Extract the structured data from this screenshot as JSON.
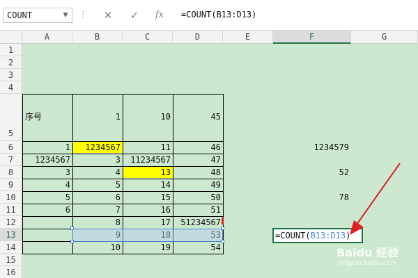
{
  "formula_bar": {
    "name_box": "COUNT",
    "cancel_icon": "✕",
    "enter_icon": "✓",
    "fx_label": "fx",
    "formula": "=COUNT(B13:D13)"
  },
  "columns": [
    "A",
    "B",
    "C",
    "D",
    "E",
    "F",
    "G"
  ],
  "active_column": "F",
  "rows": [
    "1",
    "2",
    "3",
    "4",
    "5",
    "6",
    "7",
    "8",
    "9",
    "10",
    "11",
    "12",
    "13",
    "14",
    "15",
    "16"
  ],
  "active_row": "13",
  "cells": {
    "A5": "序号",
    "B5": "1",
    "C5": "10",
    "D5": "45",
    "A6": "1",
    "B6": "1234567",
    "C6": "11",
    "D6": "46",
    "F6": "1234579",
    "A7": "1234567",
    "B7": "3",
    "C7": "11234567",
    "D7": "47",
    "A8": "3",
    "B8": "4",
    "C8": "13",
    "D8": "48",
    "F8": "52",
    "A9": "4",
    "B9": "5",
    "C9": "14",
    "D9": "49",
    "A10": "5",
    "B10": "6",
    "C10": "15",
    "D10": "50",
    "F10": "78",
    "A11": "6",
    "B11": "7",
    "C11": "16",
    "D11": "51",
    "B12": "8",
    "C12": "17",
    "D12": "51234567",
    "B13": "9",
    "C13": "18",
    "D13": "53",
    "B14": "10",
    "C14": "19",
    "D14": "54"
  },
  "highlighted_cells": [
    "B6",
    "C8"
  ],
  "editing_cell": {
    "address": "F13",
    "prefix": "=COUNT(",
    "range_ref": "B13:D13",
    "suffix": ")"
  },
  "selected_range": "B13:D13",
  "colors": {
    "sheet_background": "#cce8cf",
    "highlight": "#ffff00",
    "accent": "#217346",
    "range_ref": "#4a86e8",
    "arrow": "#e02020"
  },
  "watermark": {
    "logo": "Baidu 经验",
    "url": "jingyan.baidu.com"
  }
}
